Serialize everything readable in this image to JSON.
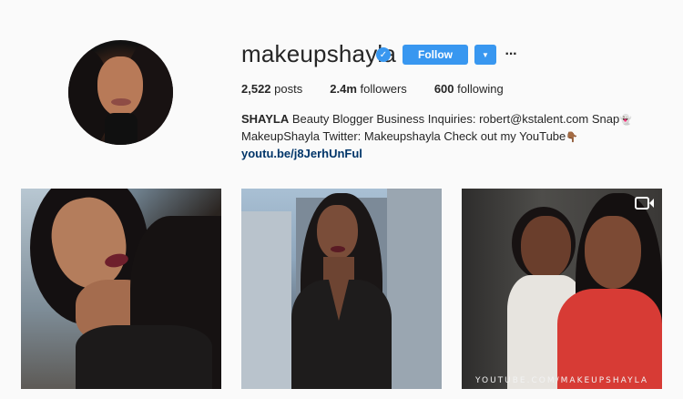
{
  "profile": {
    "username": "makeupshayla",
    "verified_icon": "verified-badge-icon",
    "follow_label": "Follow",
    "dropdown_icon": "chevron-down-icon",
    "more_icon": "more-options-icon",
    "more_label": "···"
  },
  "stats": {
    "posts_count": "2,522",
    "posts_label": "posts",
    "followers_count": "2.4m",
    "followers_label": "followers",
    "following_count": "600",
    "following_label": "following"
  },
  "bio": {
    "name": "SHAYLA",
    "line1_text": " Beauty Blogger Business Inquiries: robert@kstalent.com Snap",
    "line1_emoji": "👻",
    "line2_text": "MakeupShayla Twitter: Makeupshayla Check out my YouTube",
    "line2_emoji": "👇🏾",
    "link": "youtu.be/j8JerhUnFul"
  },
  "posts": [
    {
      "type": "photo"
    },
    {
      "type": "photo"
    },
    {
      "type": "video",
      "icon": "video-camera-icon",
      "watermark": "YOUTUBE.COM/MAKEUPSHAYLA"
    }
  ],
  "colors": {
    "accent": "#3897f0",
    "link": "#003569",
    "background": "#fafafa"
  }
}
